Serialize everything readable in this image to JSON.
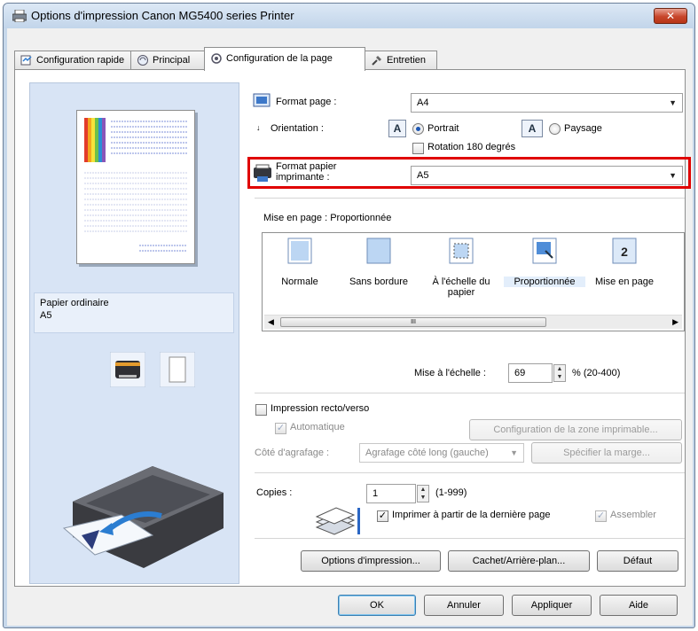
{
  "window": {
    "title": "Options d'impression Canon MG5400 series Printer",
    "close_label": "✕"
  },
  "tabs": [
    {
      "label": "Configuration rapide",
      "icon": "quick-setup-icon"
    },
    {
      "label": "Principal",
      "icon": "main-icon"
    },
    {
      "label": "Configuration de la page",
      "icon": "page-setup-icon"
    },
    {
      "label": "Entretien",
      "icon": "maintenance-icon"
    }
  ],
  "preview": {
    "paper_type": "Papier ordinaire",
    "paper_size": "A5"
  },
  "page_size": {
    "label": "Format page :",
    "value": "A4"
  },
  "orientation": {
    "label": "Orientation :",
    "portrait": "Portrait",
    "landscape": "Paysage",
    "selected": "Portrait",
    "rotate_label": "Rotation 180 degrés"
  },
  "printer_paper_size": {
    "label_line1": "Format papier",
    "label_line2": "imprimante :",
    "value": "A5"
  },
  "page_layout": {
    "label": "Mise en page : Proportionnée",
    "items": [
      {
        "label": "Normale"
      },
      {
        "label": "Sans bordure"
      },
      {
        "label_line1": "À l'échelle du",
        "label_line2": "papier"
      },
      {
        "label": "Proportionnée",
        "selected": true
      },
      {
        "label": "Mise en page",
        "icon_text": "2"
      }
    ],
    "scroll_thumb_label": "III"
  },
  "scaling": {
    "label": "Mise à l'échelle :",
    "value": "69",
    "range": "% (20-400)"
  },
  "duplex": {
    "label": "Impression recto/verso",
    "checked": false,
    "automatic_label": "Automatique",
    "print_area_button": "Configuration de la zone imprimable...",
    "stapling_label": "Côté d'agrafage :",
    "stapling_value": "Agrafage côté long (gauche)",
    "margin_button": "Spécifier la marge..."
  },
  "copies": {
    "label": "Copies :",
    "value": "1",
    "range": "(1-999)",
    "reverse_label": "Imprimer à partir de la dernière page",
    "reverse_checked": true,
    "collate_label": "Assembler",
    "collate_checked": true
  },
  "bottom_buttons": {
    "print_options": "Options d'impression...",
    "stamp_background": "Cachet/Arrière-plan...",
    "defaults": "Défaut"
  },
  "dialog_buttons": {
    "ok": "OK",
    "cancel": "Annuler",
    "apply": "Appliquer",
    "help": "Aide"
  },
  "colors": {
    "highlight": "#e00000",
    "title_bar": "#c6d7ea",
    "preview_bg": "#d8e4f5",
    "close_button": "#c7452b"
  }
}
